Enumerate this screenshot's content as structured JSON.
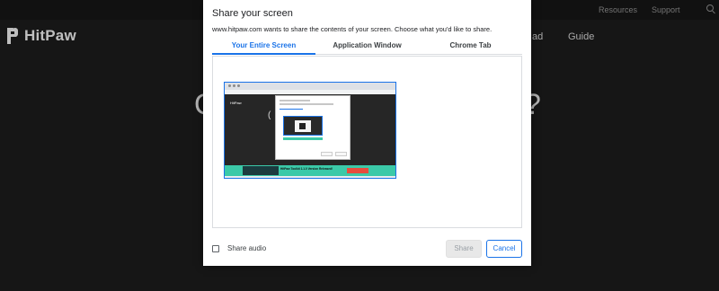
{
  "site": {
    "top_links": [
      "Resources",
      "Support"
    ],
    "logo_text": "HitPaw",
    "nav_items": [
      "ad",
      "Guide"
    ],
    "hero_left": "C",
    "hero_right": "?"
  },
  "dialog": {
    "title": "Share your screen",
    "description": "www.hitpaw.com wants to share the contents of your screen. Choose what you'd like to share.",
    "tabs": [
      {
        "label": "Your Entire Screen",
        "active": true
      },
      {
        "label": "Application Window",
        "active": false
      },
      {
        "label": "Chrome Tab",
        "active": false
      }
    ],
    "thumbnail": {
      "logo": "HitPaw",
      "banner_text": "HitPaw Toolkit 1.1.0 Version Released!",
      "banner_button": "SHOP NOW"
    },
    "share_audio_label": "Share audio",
    "share_audio_checked": false,
    "share_button": "Share",
    "cancel_button": "Cancel"
  },
  "colors": {
    "accent": "#1a73e8",
    "site_background": "#1e1e1e",
    "banner": "#3bc9a8"
  }
}
